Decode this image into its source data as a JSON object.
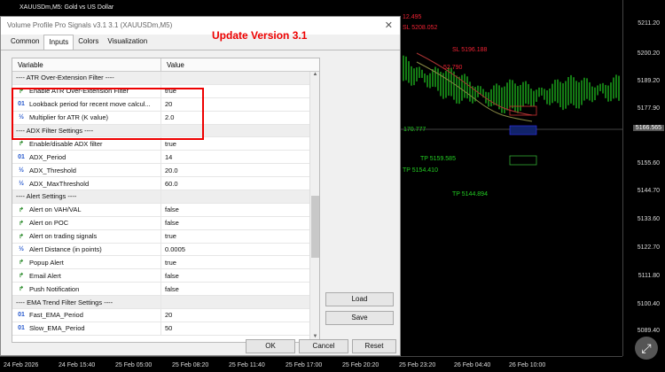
{
  "chart": {
    "title": "XAUUSDm,M5:  Gold vs US Dollar",
    "price_labels": [
      "5211.20",
      "5200.20",
      "5189.20",
      "5177.90",
      "5166.60",
      "5155.60",
      "5144.70",
      "5133.60",
      "5122.70",
      "5111.80",
      "5100.40",
      "5089.40"
    ],
    "time_labels": [
      "24 Feb 2026",
      "24 Feb 15:40",
      "25 Feb 05:00",
      "25 Feb 08:20",
      "25 Feb 11:40",
      "25 Feb 17:00",
      "25 Feb 20:20",
      "25 Feb 23:20",
      "26 Feb 04:40",
      "26 Feb 10:00"
    ],
    "annotations": [
      {
        "text": "12.495",
        "color": "red"
      },
      {
        "text": "SL 5208.052",
        "color": "red"
      },
      {
        "text": "SL 5196.188",
        "color": "red"
      },
      {
        "text": "52.790",
        "color": "red"
      },
      {
        "text": "170.777",
        "color": "green"
      },
      {
        "text": "TP 5159.585",
        "color": "green"
      },
      {
        "text": "TP 5154.410",
        "color": "green"
      },
      {
        "text": "TP 5144.894",
        "color": "green"
      }
    ],
    "current_price": "5166.565"
  },
  "dialog": {
    "title": "Volume Profile Pro Signals v3.1 3.1 (XAUUSDm,M5)",
    "update_title": "Update Version 3.1",
    "tabs": [
      "Common",
      "Inputs",
      "Colors",
      "Visualization"
    ],
    "active_tab": "Inputs",
    "columns": {
      "variable": "Variable",
      "value": "Value"
    },
    "rows": [
      {
        "type": "section",
        "name": "---- ATR Over-Extension Filter ----",
        "value": ""
      },
      {
        "type": "bool",
        "icon": "bool-arrow-icon",
        "name": "Enable ATR Over-Extension Filter",
        "value": "true"
      },
      {
        "type": "int",
        "icon": "int-icon",
        "name": "Lookback period for recent move calcul...",
        "value": "20"
      },
      {
        "type": "dbl",
        "icon": "double-icon",
        "name": "Multiplier for ATR (K value)",
        "value": "2.0"
      },
      {
        "type": "section",
        "name": "---- ADX Filter Settings ----",
        "value": ""
      },
      {
        "type": "bool",
        "icon": "bool-arrow-icon",
        "name": "Enable/disable ADX filter",
        "value": "true"
      },
      {
        "type": "int",
        "icon": "int-icon",
        "name": "ADX_Period",
        "value": "14"
      },
      {
        "type": "dbl",
        "icon": "double-icon",
        "name": "ADX_Threshold",
        "value": "20.0"
      },
      {
        "type": "dbl",
        "icon": "double-icon",
        "name": "ADX_MaxThreshold",
        "value": "60.0"
      },
      {
        "type": "section",
        "name": "---- Alert Settings ----",
        "value": ""
      },
      {
        "type": "bool",
        "icon": "bool-arrow-icon",
        "name": "Alert on VAH/VAL",
        "value": "false"
      },
      {
        "type": "bool",
        "icon": "bool-arrow-icon",
        "name": "Alert on POC",
        "value": "false"
      },
      {
        "type": "bool",
        "icon": "bool-arrow-icon",
        "name": "Alert on trading signals",
        "value": "true"
      },
      {
        "type": "dbl",
        "icon": "double-icon",
        "name": "Alert Distance (in points)",
        "value": "0.0005"
      },
      {
        "type": "bool",
        "icon": "bool-arrow-icon",
        "name": "Popup Alert",
        "value": "true"
      },
      {
        "type": "bool",
        "icon": "bool-arrow-icon",
        "name": "Email Alert",
        "value": "false"
      },
      {
        "type": "bool",
        "icon": "bool-arrow-icon",
        "name": "Push Notification",
        "value": "false"
      },
      {
        "type": "section",
        "name": "---- EMA Trend Filter Settings ----",
        "value": ""
      },
      {
        "type": "int",
        "icon": "int-icon",
        "name": "Fast_EMA_Period",
        "value": "20"
      },
      {
        "type": "int",
        "icon": "int-icon",
        "name": "Slow_EMA_Period",
        "value": "50"
      }
    ],
    "buttons": {
      "load": "Load",
      "save": "Save",
      "ok": "OK",
      "cancel": "Cancel",
      "reset": "Reset"
    }
  },
  "icons": {
    "bool": "↱",
    "int": "01",
    "dbl": "½"
  }
}
